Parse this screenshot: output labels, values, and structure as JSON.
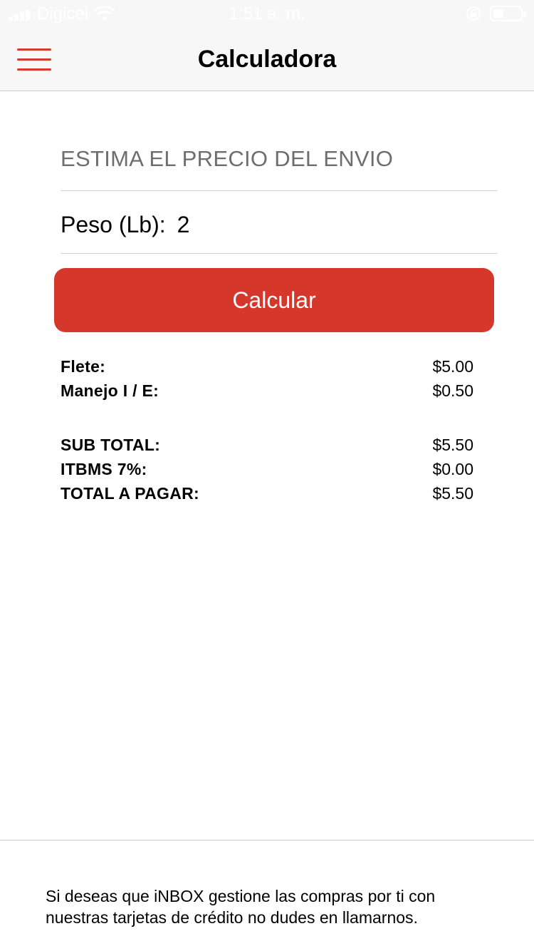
{
  "status_bar": {
    "carrier": "Digicel",
    "time": "1:51 a. m."
  },
  "nav": {
    "title": "Calculadora"
  },
  "form": {
    "section_title": "ESTIMA EL PRECIO DEL ENVIO",
    "weight_label": "Peso (Lb):",
    "weight_value": "2",
    "calc_button": "Calcular"
  },
  "results": {
    "group1": [
      {
        "label": "Flete:",
        "value": "$5.00"
      },
      {
        "label": "Manejo I / E:",
        "value": "$0.50"
      }
    ],
    "group2": [
      {
        "label": "SUB TOTAL:",
        "value": "$5.50"
      },
      {
        "label": "ITBMS 7%:",
        "value": "$0.00"
      },
      {
        "label": "TOTAL A PAGAR:",
        "value": "$5.50"
      }
    ]
  },
  "footer": {
    "text": "Si deseas que iNBOX gestione las compras por ti con nuestras tarjetas de crédito no dudes en llamarnos."
  },
  "colors": {
    "accent": "#d6372b",
    "nav_background": "#f7f7f7"
  }
}
